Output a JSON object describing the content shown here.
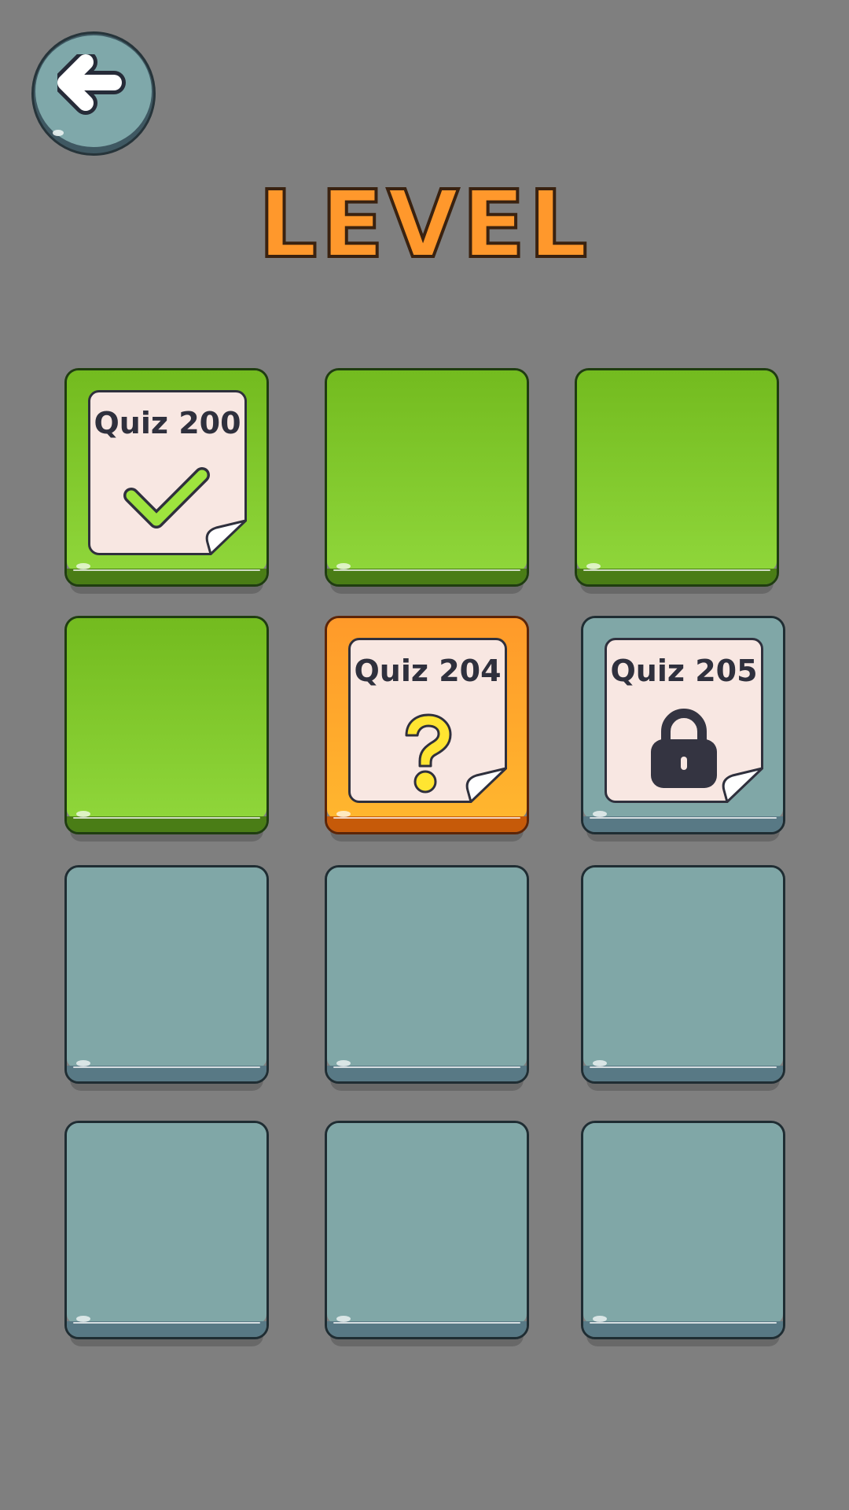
{
  "screen": {
    "title": "LEVEL"
  },
  "colors": {
    "background": "#7f7f7f",
    "title": "#ff982c",
    "completed_tile": "#8fd63a",
    "current_tile": "#ffb62e",
    "locked_tile": "#80a7a7",
    "card": "#f8e7e2"
  },
  "levels": [
    {
      "state": "completed",
      "label": "Quiz 200",
      "icon": "check-icon"
    },
    {
      "state": "completed",
      "label": "",
      "icon": ""
    },
    {
      "state": "completed",
      "label": "",
      "icon": ""
    },
    {
      "state": "completed",
      "label": "",
      "icon": ""
    },
    {
      "state": "current",
      "label": "Quiz 204",
      "icon": "question-mark-icon"
    },
    {
      "state": "locked",
      "label": "Quiz 205",
      "icon": "padlock-icon"
    },
    {
      "state": "locked",
      "label": "",
      "icon": ""
    },
    {
      "state": "locked",
      "label": "",
      "icon": ""
    },
    {
      "state": "locked",
      "label": "",
      "icon": ""
    },
    {
      "state": "locked",
      "label": "",
      "icon": ""
    },
    {
      "state": "locked",
      "label": "",
      "icon": ""
    },
    {
      "state": "locked",
      "label": "",
      "icon": ""
    }
  ]
}
